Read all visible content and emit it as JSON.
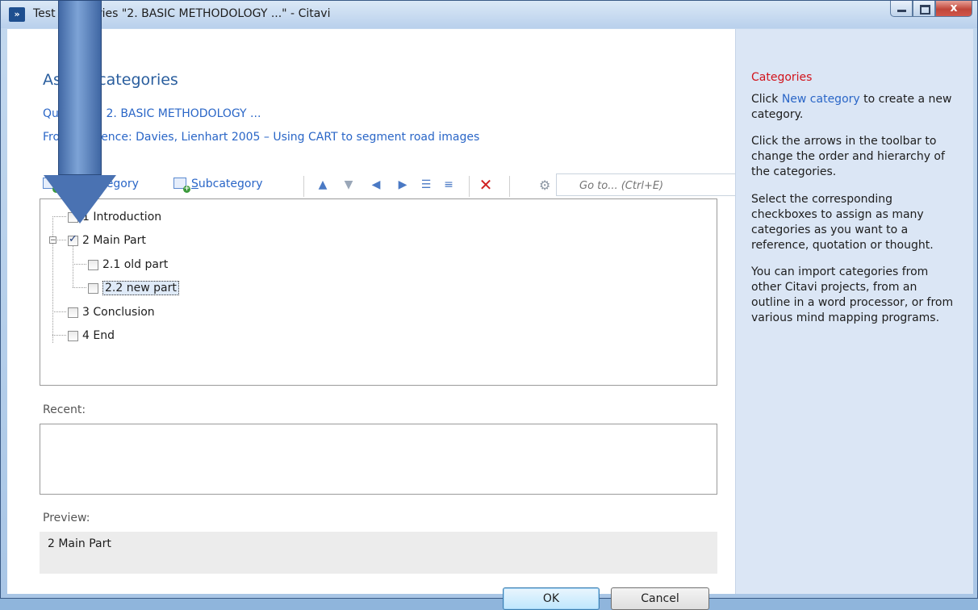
{
  "window": {
    "title": "Test categories \"2. BASIC METHODOLOGY ...\" - Citavi",
    "app_icon": "»",
    "close_glyph": "x"
  },
  "main": {
    "heading": "Assign categories",
    "quotation_line": "Quotation: 2. BASIC METHODOLOGY ...",
    "reference_line": "From reference: Davies, Lienhart 2005 – Using CART to segment road images"
  },
  "toolbar": {
    "new_category_label": "New category",
    "subcategory_rest": "ubcategory",
    "subcategory_accel": "S",
    "goto_placeholder": "Go to... (Ctrl+E)",
    "icons": [
      "new-category-icon",
      "subcategory-icon",
      "move-up-icon",
      "move-down-icon",
      "move-left-icon",
      "move-right-icon",
      "expand-all-icon",
      "collapse-all-icon",
      "delete-icon",
      "settings-icon"
    ]
  },
  "tree": {
    "items": [
      {
        "label": "1 Introduction",
        "checked": false
      },
      {
        "label": "2 Main Part",
        "checked": true
      },
      {
        "label": "2.1 old part",
        "checked": false
      },
      {
        "label": "2.2 new part",
        "checked": false,
        "selected": true
      },
      {
        "label": "3 Conclusion",
        "checked": false
      },
      {
        "label": "4 End",
        "checked": false
      }
    ]
  },
  "recent": {
    "label": "Recent:"
  },
  "preview": {
    "label": "Preview:",
    "text": "2 Main Part"
  },
  "buttons": {
    "ok": "OK",
    "cancel": "Cancel"
  },
  "help": {
    "title": "Categories",
    "p1_pre": "Click ",
    "p1_link": "New category",
    "p1_post": " to create a new category.",
    "p2": "Click the arrows in the toolbar to change the order and hierarchy of the categories.",
    "p3": "Select the corresponding checkboxes to assign as many categories as you want to a reference, quotation or thought.",
    "p4": "You can import categories from other Citavi projects, from an outline in a word processor, or from various mind mapping programs."
  },
  "colors": {
    "accent_link": "#2a66c7",
    "help_title": "#d2131b",
    "annotation_arrow": "#4a72b2"
  }
}
